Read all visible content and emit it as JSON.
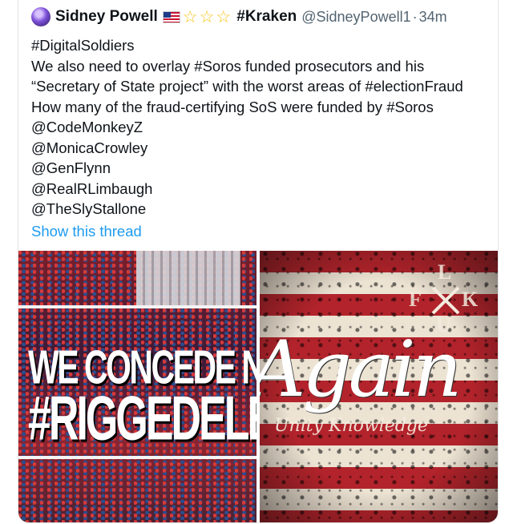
{
  "tweet": {
    "author_name": "Sidney Powell",
    "emoji_flag": "flag-us-icon",
    "stars": [
      "star-icon",
      "star-icon",
      "star-icon"
    ],
    "name_suffix": "#Kraken",
    "handle": "@SidneyPowell1",
    "separator": "·",
    "time": "34m",
    "lines": [
      "#DigitalSoldiers",
      "We also need to overlay #Soros funded prosecutors and his",
      "“Secretary of State project” with the worst areas of #electionFraud",
      "How many of the fraud-certifying SoS were funded by #Soros",
      "@CodeMonkeyZ",
      "@MonicaCrowley",
      "@GenFlynn",
      "@RealRLimbaugh",
      "@TheSlyStallone"
    ],
    "show_thread": "Show this thread"
  },
  "media": {
    "left_image": {
      "line1": "WE CONCEDE NOTHING",
      "line2": "#RIGGEDELECTION"
    },
    "right_image": {
      "letters": [
        "L",
        "F",
        "K",
        "U"
      ],
      "script_word": "Again",
      "tagline": "Unity Knowledge"
    }
  },
  "colors": {
    "link": "#1d9bf0",
    "text": "#0f1419",
    "muted": "#536471",
    "flag_red": "#b3232b",
    "flag_cream": "#ece3d3"
  }
}
